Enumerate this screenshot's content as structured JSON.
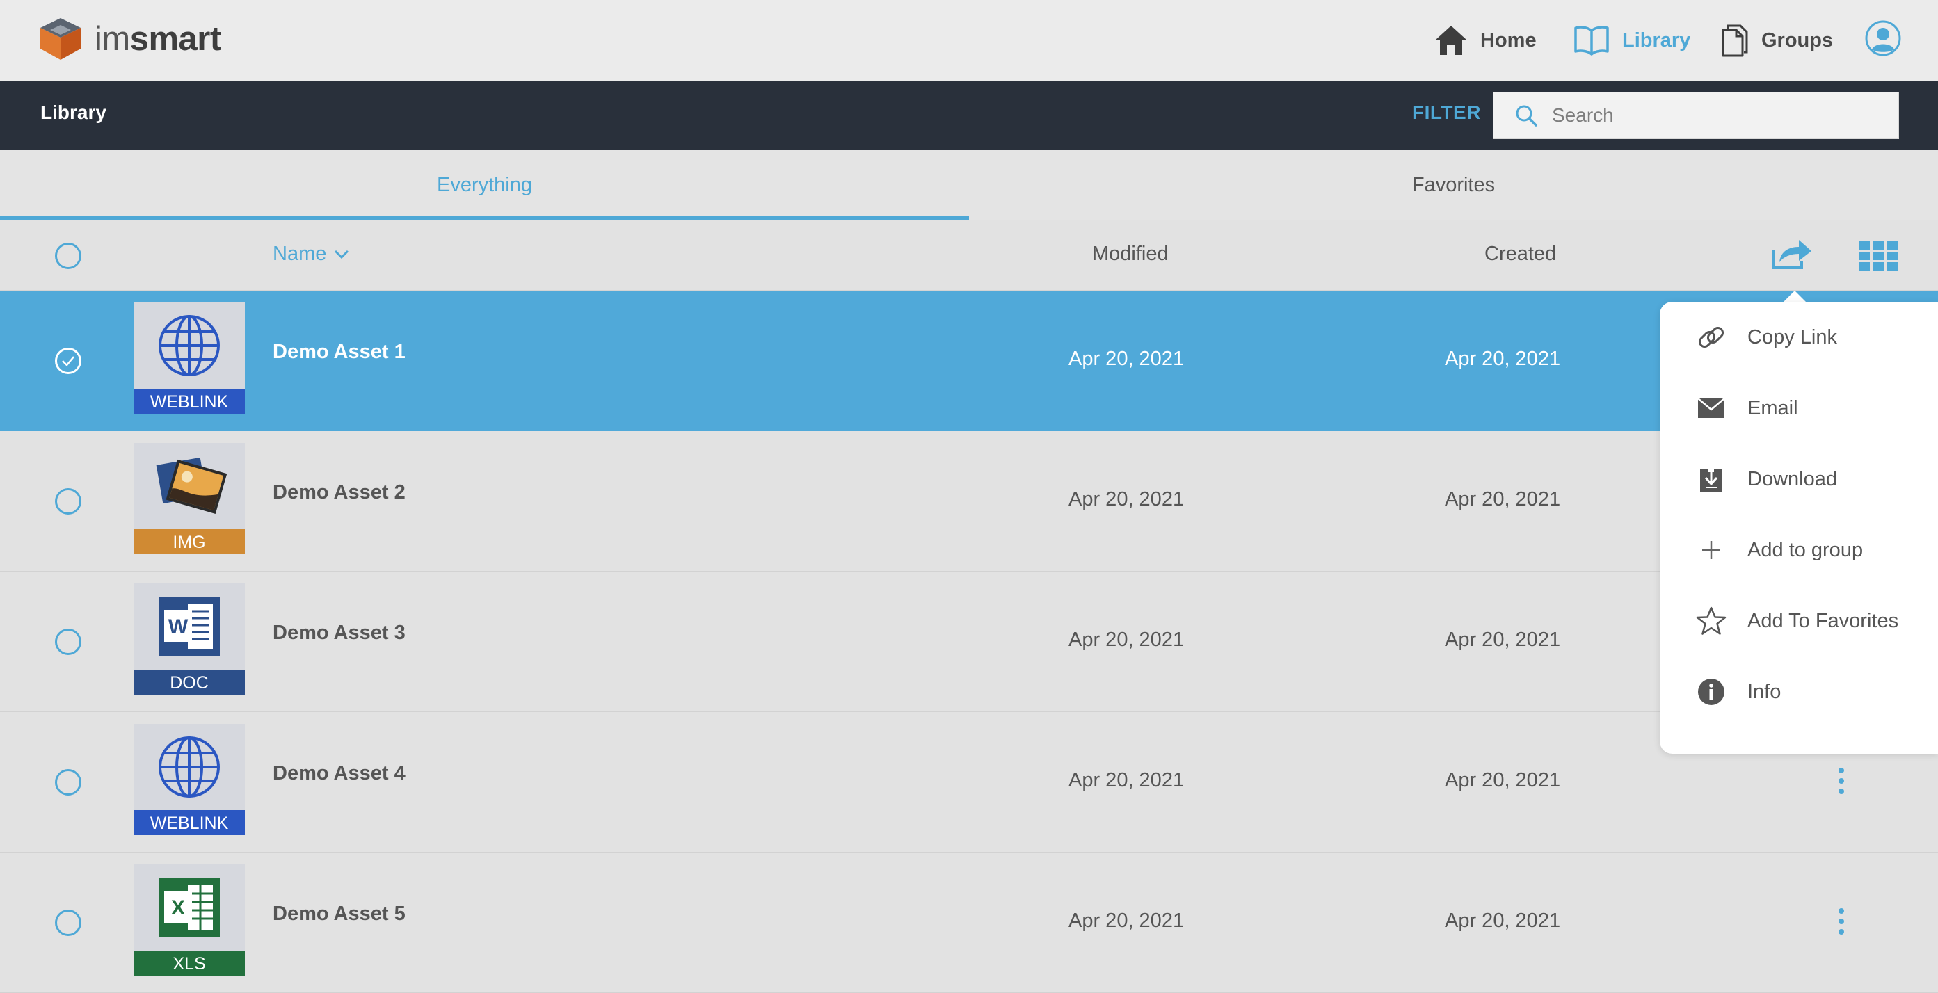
{
  "brand": {
    "name_prefix": "im",
    "name_suffix": "smart"
  },
  "nav": {
    "home": "Home",
    "library": "Library",
    "groups": "Groups"
  },
  "toolbar": {
    "title": "Library",
    "filter": "FILTER",
    "search_placeholder": "Search"
  },
  "tabs": [
    {
      "label": "Everything",
      "active": true
    },
    {
      "label": "Favorites",
      "active": false
    }
  ],
  "columns": {
    "name": "Name",
    "modified": "Modified",
    "created": "Created"
  },
  "assets": [
    {
      "name": "Demo Asset 1",
      "type": "WEBLINK",
      "modified": "Apr 20, 2021",
      "created": "Apr 20, 2021",
      "selected": true
    },
    {
      "name": "Demo Asset 2",
      "type": "IMG",
      "modified": "Apr 20, 2021",
      "created": "Apr 20, 2021",
      "selected": false
    },
    {
      "name": "Demo Asset 3",
      "type": "DOC",
      "modified": "Apr 20, 2021",
      "created": "Apr 20, 2021",
      "selected": false
    },
    {
      "name": "Demo Asset 4",
      "type": "WEBLINK",
      "modified": "Apr 20, 2021",
      "created": "Apr 20, 2021",
      "selected": false
    },
    {
      "name": "Demo Asset 5",
      "type": "XLS",
      "modified": "Apr 20, 2021",
      "created": "Apr 20, 2021",
      "selected": false
    }
  ],
  "share_menu": [
    {
      "label": "Copy Link",
      "icon": "link-icon"
    },
    {
      "label": "Email",
      "icon": "envelope-icon"
    },
    {
      "label": "Download",
      "icon": "download-icon"
    },
    {
      "label": "Add to group",
      "icon": "plus-icon"
    },
    {
      "label": "Add To Favorites",
      "icon": "star-icon"
    },
    {
      "label": "Info",
      "icon": "info-icon"
    }
  ],
  "colors": {
    "accent": "#4ea8d6",
    "selected_row": "#50a9d9",
    "toolbar_bg": "#29303b",
    "page_bg": "#e2e2e2"
  }
}
